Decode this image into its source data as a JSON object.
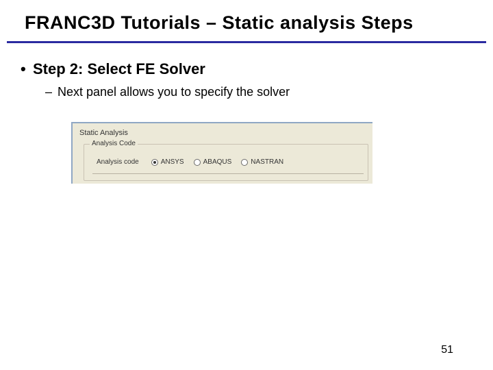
{
  "title": "FRANC3D Tutorials – Static analysis Steps",
  "bullet_lvl1": "Step 2: Select FE Solver",
  "bullet_lvl2": "Next panel allows you to specify the solver",
  "panel": {
    "window_title": "Static Analysis",
    "group_label": "Analysis Code",
    "row_label": "Analysis code",
    "options": {
      "ansys": "ANSYS",
      "abaqus": "ABAQUS",
      "nastran": "NASTRAN"
    },
    "selected": "ansys"
  },
  "page_number": "51"
}
